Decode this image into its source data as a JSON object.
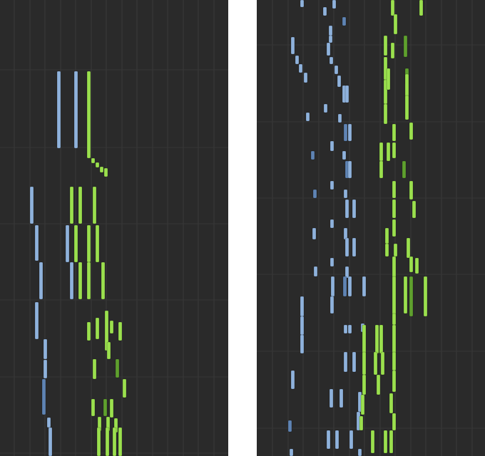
{
  "colors": {
    "background": "#2a2a2a",
    "grid_line": "#3b3b3b",
    "row_line": "#353535",
    "blue_note": "#8fb2dc",
    "blue_note_dim": "#5f84b4",
    "green_note": "#9be04e",
    "green_note_dim": "#5fa02e"
  },
  "panels": {
    "left": {
      "label": "piano-roll-left"
    },
    "right": {
      "label": "piano-roll-right"
    }
  }
}
